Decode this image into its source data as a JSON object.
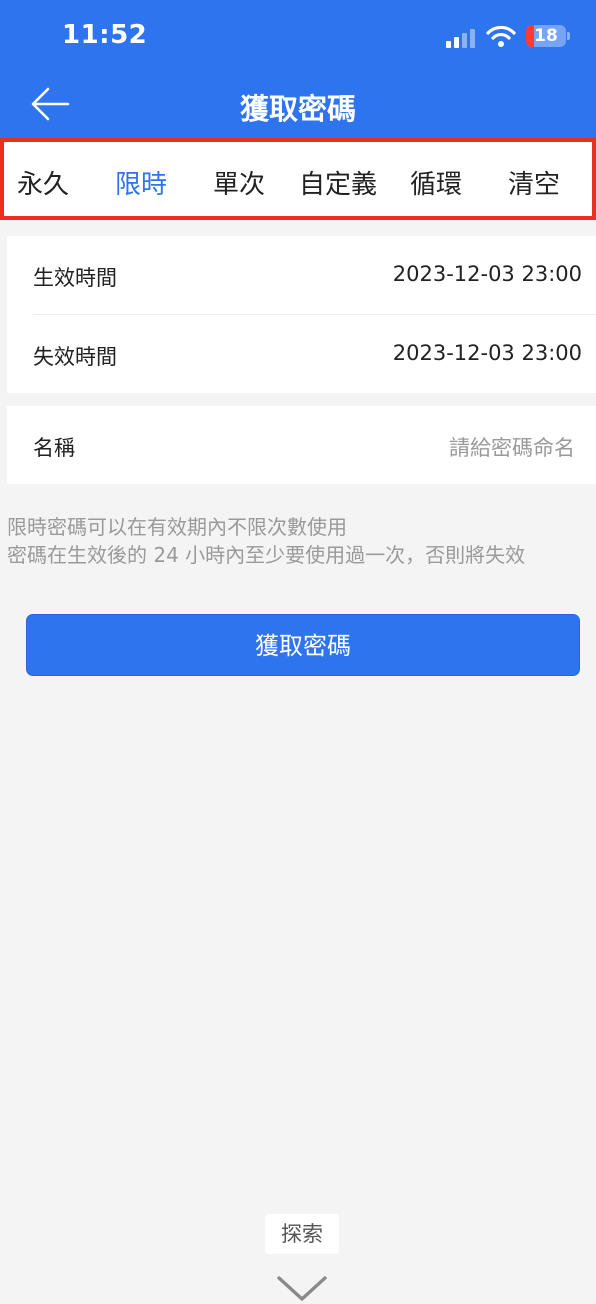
{
  "status_bar": {
    "time": "11:52",
    "battery": "18"
  },
  "nav": {
    "title": "獲取密碼"
  },
  "tabs": [
    {
      "label": "永久",
      "active": false
    },
    {
      "label": "限時",
      "active": true
    },
    {
      "label": "單次",
      "active": false
    },
    {
      "label": "自定義",
      "active": false
    },
    {
      "label": "循環",
      "active": false
    },
    {
      "label": "清空",
      "active": false
    }
  ],
  "time_card": {
    "start_label": "生效時間",
    "start_value": "2023-12-03 23:00",
    "end_label": "失效時間",
    "end_value": "2023-12-03 23:00"
  },
  "name_card": {
    "label": "名稱",
    "placeholder": "請給密碼命名"
  },
  "hint": {
    "line1": "限時密碼可以在有效期內不限次數使用",
    "line2": "密碼在生效後的 24 小時內至少要使用過一次，否則將失效"
  },
  "primary_button": {
    "label": "獲取密碼"
  },
  "bottom": {
    "explore_label": "探索"
  },
  "colors": {
    "brand": "#2f74ef",
    "highlight_border": "#e8301c"
  }
}
